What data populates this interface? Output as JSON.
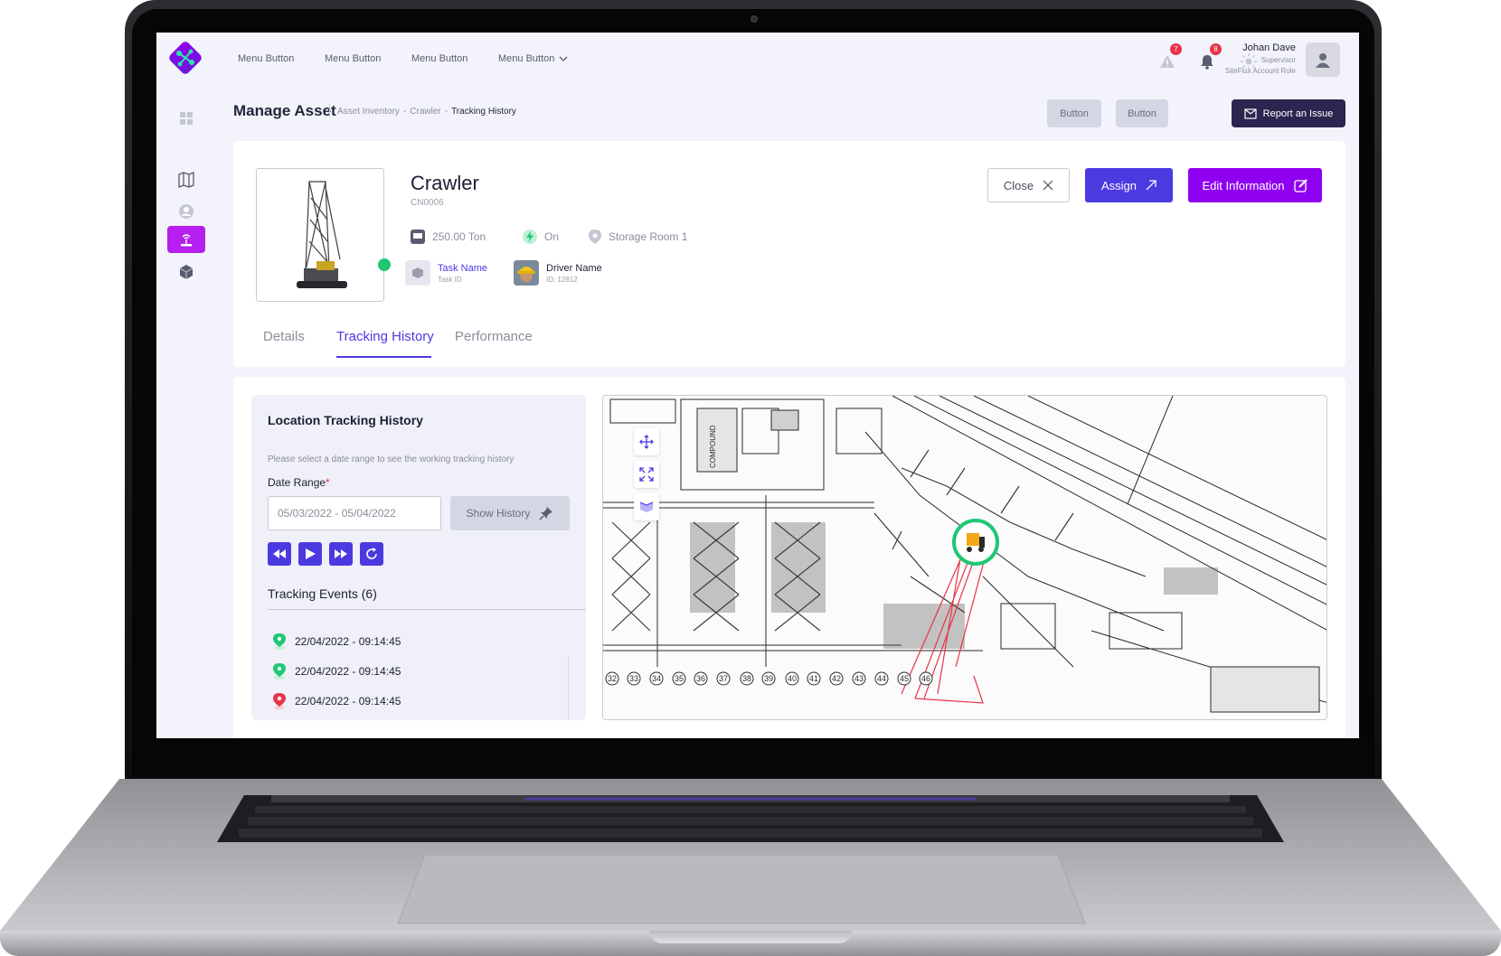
{
  "topbar": {
    "menu": [
      "Menu Button",
      "Menu Button",
      "Menu Button",
      "Menu Button"
    ],
    "alerts_count": "7",
    "notifications_count": "8",
    "user": {
      "name": "Johan Dave",
      "role": "Supervisor",
      "account": "SiteFlux Account Role"
    }
  },
  "header": {
    "title": "Manage Asset",
    "breadcrumb": [
      "Asset Inventory",
      "-",
      "Crawler",
      "-",
      "Tracking History"
    ],
    "button1": "Button",
    "button2": "Button",
    "report": "Report an Issue"
  },
  "asset": {
    "name": "Crawler",
    "code": "CN0006",
    "weight": "250.00 Ton",
    "power": "On",
    "location": "Storage Room 1",
    "task": {
      "name": "Task Name",
      "id": "Task ID"
    },
    "driver": {
      "name": "Driver Name",
      "id": "ID: 12812"
    }
  },
  "actions": {
    "close": "Close",
    "assign": "Assign",
    "edit": "Edit Information"
  },
  "tabs": [
    "Details",
    "Tracking History",
    "Performance"
  ],
  "active_tab": "Tracking History",
  "tracking": {
    "title": "Location Tracking History",
    "hint": "Please select a date range to see the working tracking history",
    "date_label": "Date Range",
    "required_mark": "*",
    "date_value": "05/03/2022  -  05/04/2022",
    "show_history": "Show History",
    "events_title": "Tracking Events (6)",
    "events": [
      {
        "time": "22/04/2022 - 09:14:45",
        "color": "#1fc774"
      },
      {
        "time": "22/04/2022 - 09:14:45",
        "color": "#1fc774"
      },
      {
        "time": "22/04/2022 - 09:14:45",
        "color": "#e8334a"
      }
    ]
  },
  "map": {
    "grid_labels": [
      "32",
      "33",
      "34",
      "35",
      "36",
      "37",
      "38",
      "39",
      "40",
      "41",
      "42",
      "43",
      "44",
      "45",
      "46"
    ],
    "compound_label": "COMPOUND"
  },
  "colors": {
    "primary": "#4b3ae0",
    "accent": "#9000f0",
    "dark": "#2b2550",
    "status": "#1fc774",
    "danger": "#e8334a"
  }
}
